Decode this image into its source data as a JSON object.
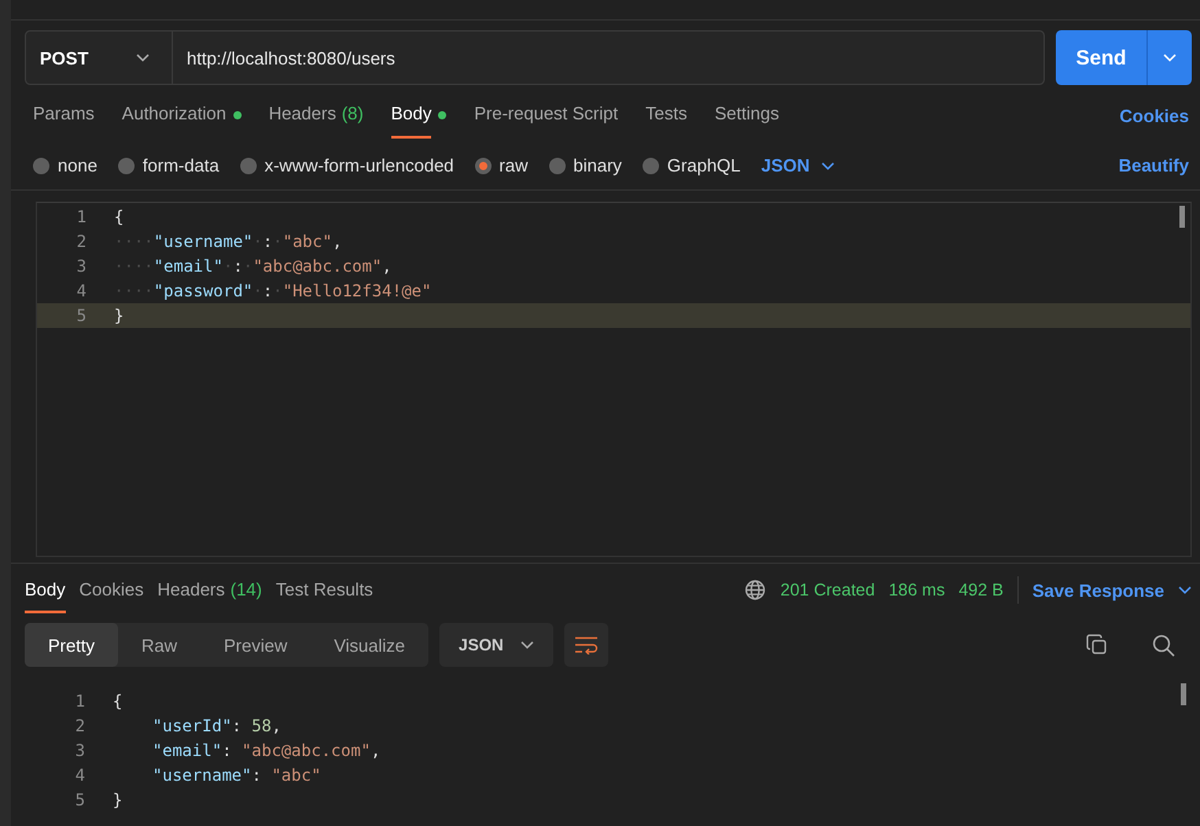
{
  "request": {
    "method": "POST",
    "url": "http://localhost:8080/users",
    "send": "Send"
  },
  "request_tabs": [
    {
      "label": "Params",
      "dot": false,
      "selected": false
    },
    {
      "label": "Authorization",
      "dot": true,
      "selected": false
    },
    {
      "label": "Headers",
      "count": "(8)",
      "dot": false,
      "selected": false
    },
    {
      "label": "Body",
      "dot": true,
      "selected": true
    },
    {
      "label": "Pre-request Script",
      "dot": false,
      "selected": false
    },
    {
      "label": "Tests",
      "dot": false,
      "selected": false
    },
    {
      "label": "Settings",
      "dot": false,
      "selected": false
    }
  ],
  "cookies_link": "Cookies",
  "body_types": [
    {
      "label": "none",
      "selected": false
    },
    {
      "label": "form-data",
      "selected": false
    },
    {
      "label": "x-www-form-urlencoded",
      "selected": false
    },
    {
      "label": "raw",
      "selected": true
    },
    {
      "label": "binary",
      "selected": false
    },
    {
      "label": "GraphQL",
      "selected": false
    }
  ],
  "raw_format": "JSON",
  "beautify": "Beautify",
  "request_editor": [
    {
      "number": "1",
      "current": false,
      "tokens": [
        {
          "kind": "punct",
          "text": "{"
        }
      ]
    },
    {
      "number": "2",
      "current": false,
      "tokens": [
        {
          "kind": "ws",
          "text": "····"
        },
        {
          "kind": "key",
          "text": "\"username\""
        },
        {
          "kind": "ws",
          "text": "·"
        },
        {
          "kind": "punct",
          "text": ":"
        },
        {
          "kind": "ws",
          "text": "·"
        },
        {
          "kind": "string",
          "text": "\"abc\""
        },
        {
          "kind": "punct",
          "text": ","
        }
      ]
    },
    {
      "number": "3",
      "current": false,
      "tokens": [
        {
          "kind": "ws",
          "text": "····"
        },
        {
          "kind": "key",
          "text": "\"email\""
        },
        {
          "kind": "ws",
          "text": "·"
        },
        {
          "kind": "punct",
          "text": ":"
        },
        {
          "kind": "ws",
          "text": "·"
        },
        {
          "kind": "string",
          "text": "\"abc@abc.com\""
        },
        {
          "kind": "punct",
          "text": ","
        }
      ]
    },
    {
      "number": "4",
      "current": false,
      "tokens": [
        {
          "kind": "ws",
          "text": "····"
        },
        {
          "kind": "key",
          "text": "\"password\""
        },
        {
          "kind": "ws",
          "text": "·"
        },
        {
          "kind": "punct",
          "text": ":"
        },
        {
          "kind": "ws",
          "text": "·"
        },
        {
          "kind": "string",
          "text": "\"Hello12f34!@e\""
        }
      ]
    },
    {
      "number": "5",
      "current": true,
      "tokens": [
        {
          "kind": "punct",
          "text": "}"
        }
      ]
    }
  ],
  "response_tabs": [
    {
      "label": "Body",
      "selected": true
    },
    {
      "label": "Cookies",
      "selected": false
    },
    {
      "label": "Headers",
      "count": "(14)",
      "selected": false
    },
    {
      "label": "Test Results",
      "selected": false
    }
  ],
  "response_status": {
    "status": "201 Created",
    "time": "186 ms",
    "size": "492 B",
    "save": "Save Response"
  },
  "view_modes": [
    {
      "label": "Pretty",
      "selected": true
    },
    {
      "label": "Raw",
      "selected": false
    },
    {
      "label": "Preview",
      "selected": false
    },
    {
      "label": "Visualize",
      "selected": false
    }
  ],
  "response_format": "JSON",
  "response_editor": [
    {
      "number": "1",
      "current": false,
      "tokens": [
        {
          "kind": "punct",
          "text": "{"
        }
      ]
    },
    {
      "number": "2",
      "current": false,
      "tokens": [
        {
          "kind": "key",
          "text": "\"userId\""
        },
        {
          "kind": "punct",
          "text": ": "
        },
        {
          "kind": "number",
          "text": "58"
        },
        {
          "kind": "punct",
          "text": ","
        }
      ]
    },
    {
      "number": "3",
      "current": false,
      "tokens": [
        {
          "kind": "key",
          "text": "\"email\""
        },
        {
          "kind": "punct",
          "text": ": "
        },
        {
          "kind": "string",
          "text": "\"abc@abc.com\""
        },
        {
          "kind": "punct",
          "text": ","
        }
      ]
    },
    {
      "number": "4",
      "current": false,
      "tokens": [
        {
          "kind": "key",
          "text": "\"username\""
        },
        {
          "kind": "punct",
          "text": ": "
        },
        {
          "kind": "string",
          "text": "\"abc\""
        }
      ]
    },
    {
      "number": "5",
      "current": false,
      "tokens": [
        {
          "kind": "punct",
          "text": "}"
        }
      ]
    }
  ]
}
